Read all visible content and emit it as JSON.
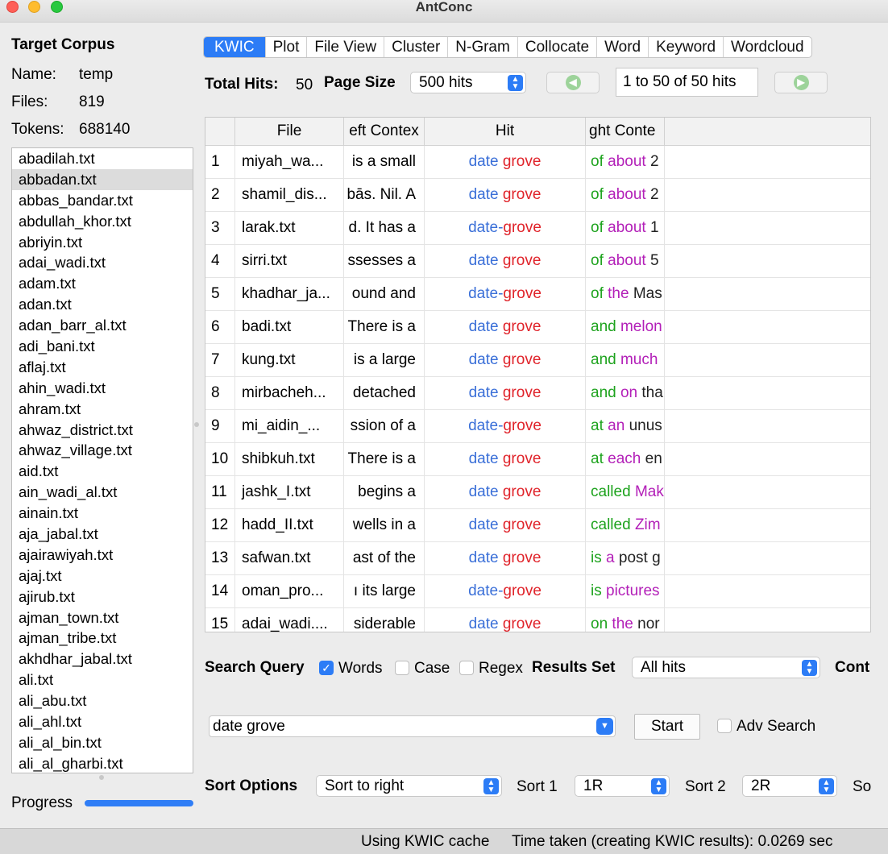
{
  "window": {
    "title": "AntConc"
  },
  "corpus": {
    "heading": "Target Corpus",
    "name_label": "Name:",
    "name_value": "temp",
    "files_label": "Files:",
    "files_value": "819",
    "tokens_label": "Tokens:",
    "tokens_value": "688140",
    "selected_index": 1,
    "files": [
      "abadilah.txt",
      "abbadan.txt",
      "abbas_bandar.txt",
      "abdullah_khor.txt",
      "abriyin.txt",
      "adai_wadi.txt",
      "adam.txt",
      "adan.txt",
      "adan_barr_al.txt",
      "adi_bani.txt",
      "aflaj.txt",
      "ahin_wadi.txt",
      "ahram.txt",
      "ahwaz_district.txt",
      "ahwaz_village.txt",
      "aid.txt",
      "ain_wadi_al.txt",
      "ainain.txt",
      "aja_jabal.txt",
      "ajairawiyah.txt",
      "ajaj.txt",
      "ajirub.txt",
      "ajman_town.txt",
      "ajman_tribe.txt",
      "akhdhar_jabal.txt",
      "ali.txt",
      "ali_abu.txt",
      "ali_ahl.txt",
      "ali_al_bin.txt",
      "ali_al_gharbi.txt"
    ],
    "progress_label": "Progress",
    "progress": 1.0
  },
  "tabs": [
    "KWIC",
    "Plot",
    "File View",
    "Cluster",
    "N-Gram",
    "Collocate",
    "Word",
    "Keyword",
    "Wordcloud"
  ],
  "active_tab": "KWIC",
  "hits": {
    "total_label": "Total Hits:",
    "total_value": "50",
    "page_size_label": "Page Size",
    "page_size_value": "500 hits",
    "range": "1 to 50 of 50 hits"
  },
  "table": {
    "headers": {
      "file": "File",
      "left": "eft Contex",
      "hit": "Hit",
      "right": "ght Conte"
    },
    "rows": [
      {
        "n": "1",
        "file": "miyah_wa...",
        "left": "is a small",
        "hit1": "date",
        "sep": " ",
        "hit2": "grove",
        "r1": "of",
        "r2": "about",
        "r2c": "p",
        "r3": "2"
      },
      {
        "n": "2",
        "file": "shamil_dis...",
        "left": "bās. Nil. A",
        "hit1": "date",
        "sep": " ",
        "hit2": "grove",
        "r1": "of",
        "r2": "about",
        "r2c": "p",
        "r3": "2"
      },
      {
        "n": "3",
        "file": "larak.txt",
        "left": "d. It has a",
        "hit1": "date",
        "sep": "-",
        "hit2": "grove",
        "r1": "of",
        "r2": "about",
        "r2c": "p",
        "r3": "1"
      },
      {
        "n": "4",
        "file": "sirri.txt",
        "left": "ssesses a",
        "hit1": "date",
        "sep": " ",
        "hit2": "grove",
        "r1": "of",
        "r2": "about",
        "r2c": "p",
        "r3": "5"
      },
      {
        "n": "5",
        "file": "khadhar_ja...",
        "left": "ound and",
        "hit1": "date",
        "sep": "-",
        "hit2": "grove",
        "r1": "of",
        "r2": "the",
        "r2c": "p",
        "r3": "Mas"
      },
      {
        "n": "6",
        "file": "badi.txt",
        "left": "There is a",
        "hit1": "date",
        "sep": " ",
        "hit2": "grove",
        "r1": "and",
        "r2": "melon",
        "r2c": "p",
        "r3": ""
      },
      {
        "n": "7",
        "file": "kung.txt",
        "left": "is a large",
        "hit1": "date",
        "sep": " ",
        "hit2": "grove",
        "r1": "and",
        "r2": "much",
        "r2c": "p",
        "r3": ""
      },
      {
        "n": "8",
        "file": "mirbacheh...",
        "left": "detached",
        "hit1": "date",
        "sep": " ",
        "hit2": "grove",
        "r1": "and",
        "r2": "on",
        "r2c": "p",
        "r3": "tha"
      },
      {
        "n": "9",
        "file": "mi_aidin_...",
        "left": "ssion of a",
        "hit1": "date",
        "sep": "-",
        "hit2": "grove",
        "r1": "at",
        "r2": "an",
        "r2c": "p",
        "r3": "unus"
      },
      {
        "n": "10",
        "file": "shibkuh.txt",
        "left": "There is a",
        "hit1": "date",
        "sep": " ",
        "hit2": "grove",
        "r1": "at",
        "r2": "each",
        "r2c": "p",
        "r3": "en"
      },
      {
        "n": "11",
        "file": "jashk_I.txt",
        "left": "begins a",
        "hit1": "date",
        "sep": " ",
        "hit2": "grove",
        "r1": "called",
        "r2": "Mak",
        "r2c": "p",
        "r3": ""
      },
      {
        "n": "12",
        "file": "hadd_II.txt",
        "left": "wells in a",
        "hit1": "date",
        "sep": " ",
        "hit2": "grove",
        "r1": "called",
        "r2": "Zim",
        "r2c": "p",
        "r3": ""
      },
      {
        "n": "13",
        "file": "safwan.txt",
        "left": "ast of the",
        "hit1": "date",
        "sep": " ",
        "hit2": "grove",
        "r1": "is",
        "r2": "a",
        "r2c": "p",
        "r3": "post g"
      },
      {
        "n": "14",
        "file": "oman_pro...",
        "left": "ı its large",
        "hit1": "date",
        "sep": "-",
        "hit2": "grove",
        "r1": "is",
        "r2": "pictures",
        "r2c": "p",
        "r3": ""
      },
      {
        "n": "15",
        "file": "adai_wadi....",
        "left": "siderable",
        "hit1": "date",
        "sep": " ",
        "hit2": "grove",
        "r1": "on",
        "r2": "the",
        "r2c": "p",
        "r3": "nor"
      }
    ]
  },
  "search": {
    "query_label": "Search Query",
    "words_label": "Words",
    "words_checked": true,
    "case_label": "Case",
    "case_checked": false,
    "regex_label": "Regex",
    "regex_checked": false,
    "results_set_label": "Results Set",
    "results_set_value": "All hits",
    "context_label": "Cont",
    "query_value": "date grove",
    "start_label": "Start",
    "adv_label": "Adv Search",
    "adv_checked": false
  },
  "sort": {
    "label": "Sort Options",
    "mode_value": "Sort to right",
    "sort1_label": "Sort 1",
    "sort1_value": "1R",
    "sort2_label": "Sort 2",
    "sort2_value": "2R",
    "sort3_label": "So"
  },
  "status": {
    "cache": "Using KWIC cache",
    "time": "Time taken (creating KWIC results):  0.0269 sec"
  },
  "colors": {
    "accent": "#2c7cf6",
    "hit_word1": "#3a6fd8",
    "hit_word2": "#e0232a",
    "right_1": "#1ea31e",
    "right_2": "#b320b8"
  }
}
